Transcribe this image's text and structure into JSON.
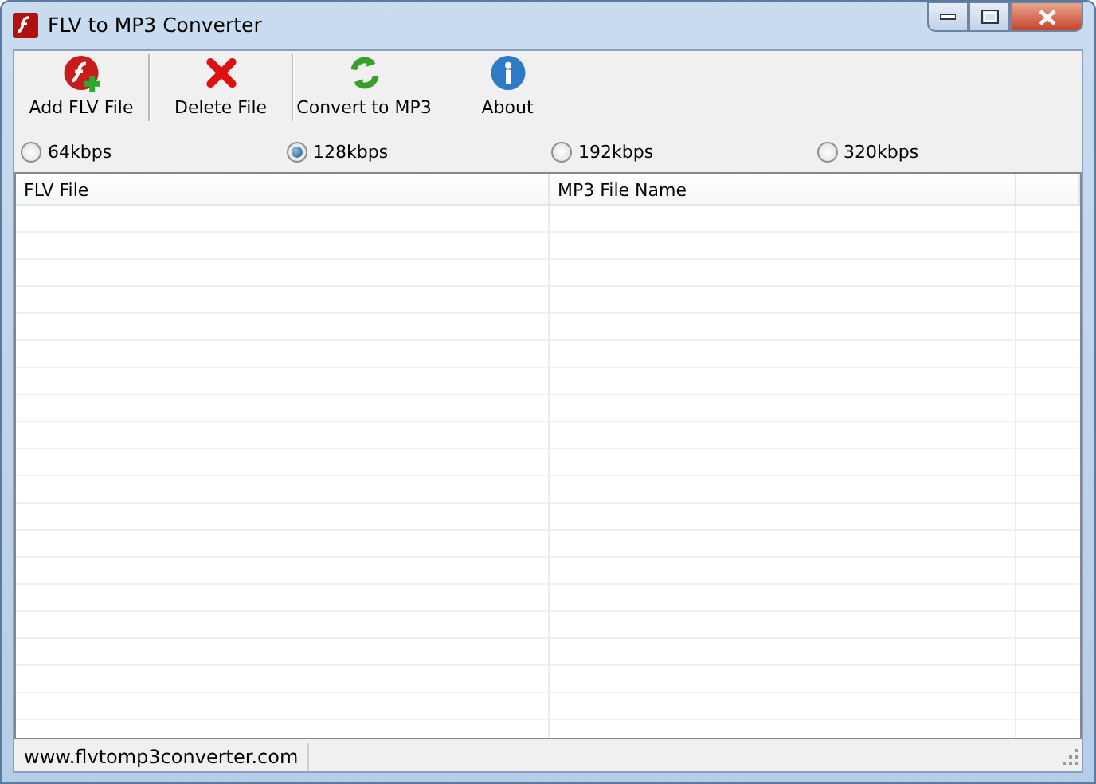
{
  "window": {
    "title": "FLV to MP3 Converter"
  },
  "toolbar": [
    {
      "kind": "add",
      "label": "Add FLV File"
    },
    {
      "kind": "delete",
      "label": "Delete File"
    },
    {
      "kind": "convert",
      "label": "Convert to MP3"
    },
    {
      "kind": "about",
      "label": "About"
    }
  ],
  "bitrates": [
    {
      "label": "64kbps",
      "selected": false
    },
    {
      "label": "128kbps",
      "selected": true
    },
    {
      "label": "192kbps",
      "selected": false
    },
    {
      "label": "320kbps",
      "selected": false
    }
  ],
  "table": {
    "columns": [
      "FLV File",
      "MP3 File Name"
    ]
  },
  "status_bar": "www.flvtomp3converter.com"
}
